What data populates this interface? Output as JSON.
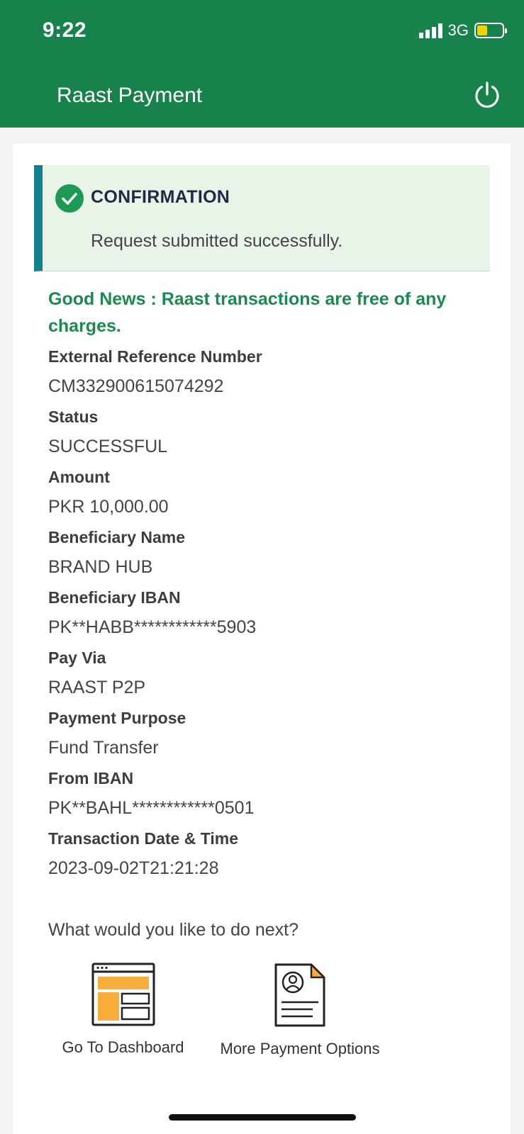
{
  "status_bar": {
    "time": "9:22",
    "network": "3G"
  },
  "header": {
    "title": "Raast Payment",
    "logout_icon": "power-icon"
  },
  "confirmation": {
    "title": "CONFIRMATION",
    "message": "Request submitted successfully."
  },
  "notice": "Good News : Raast transactions are free of any charges.",
  "details": [
    {
      "label": "External Reference Number",
      "value": "CM332900615074292"
    },
    {
      "label": "Status",
      "value": "SUCCESSFUL"
    },
    {
      "label": "Amount",
      "value": "PKR 10,000.00"
    },
    {
      "label": "Beneficiary Name",
      "value": "BRAND HUB"
    },
    {
      "label": "Beneficiary IBAN",
      "value": "PK**HABB************5903"
    },
    {
      "label": "Pay Via",
      "value": "RAAST P2P"
    },
    {
      "label": "Payment Purpose",
      "value": "Fund Transfer"
    },
    {
      "label": "From IBAN",
      "value": "PK**BAHL************0501"
    },
    {
      "label": "Transaction Date & Time",
      "value": "2023-09-02T21:21:28"
    }
  ],
  "next": {
    "question": "What would you like to do next?",
    "actions": [
      {
        "label": "Go To Dashboard",
        "icon": "dashboard-icon"
      },
      {
        "label": "More Payment Options",
        "icon": "payment-document-icon"
      }
    ]
  },
  "colors": {
    "brand_green": "#17824b",
    "accent_teal": "#13828a",
    "success_bg": "#e8f4e8",
    "notice_green": "#1b8a4f",
    "icon_orange": "#f9ae3b"
  }
}
